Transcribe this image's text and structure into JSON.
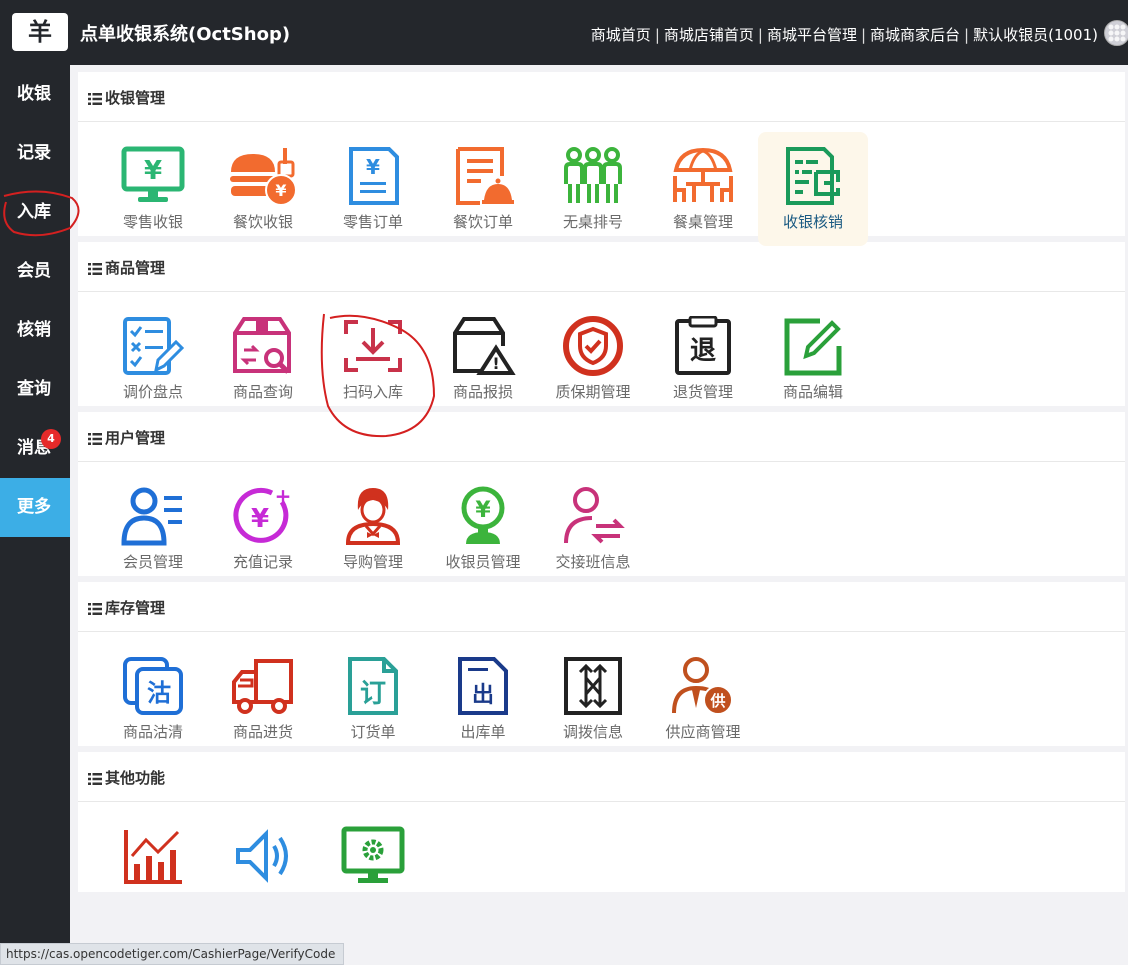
{
  "header": {
    "logo_glyph": "羊",
    "title": "点单收银系统(OctShop)",
    "links": [
      {
        "label": "商城首页"
      },
      {
        "label": "商城店铺首页"
      },
      {
        "label": "商城平台管理"
      },
      {
        "label": "商城商家后台"
      },
      {
        "label": "默认收银员(1001)"
      }
    ],
    "separator": "|"
  },
  "sidebar": {
    "items": [
      {
        "label": "收银"
      },
      {
        "label": "记录"
      },
      {
        "label": "入库"
      },
      {
        "label": "会员"
      },
      {
        "label": "核销"
      },
      {
        "label": "查询"
      },
      {
        "label": "消息",
        "badge": "4"
      },
      {
        "label": "更多",
        "active": true
      }
    ]
  },
  "sections": [
    {
      "title": "收银管理",
      "items": [
        {
          "label": "零售收银",
          "icon": "monitor-yen-icon",
          "color": "#2bb673"
        },
        {
          "label": "餐饮收银",
          "icon": "burger-yen-icon",
          "color": "#f26b2f"
        },
        {
          "label": "零售订单",
          "icon": "document-yen-icon",
          "color": "#2e8de0"
        },
        {
          "label": "餐饮订单",
          "icon": "food-order-icon",
          "color": "#f26b2f"
        },
        {
          "label": "无桌排号",
          "icon": "people-queue-icon",
          "color": "#3cb43c"
        },
        {
          "label": "餐桌管理",
          "icon": "table-umbrella-icon",
          "color": "#f26b2f"
        },
        {
          "label": "收银核销",
          "icon": "scan-verify-icon",
          "color": "#1a9a5a",
          "active": true
        }
      ]
    },
    {
      "title": "商品管理",
      "items": [
        {
          "label": "调价盘点",
          "icon": "checklist-pencil-icon",
          "color": "#2e8de0"
        },
        {
          "label": "商品查询",
          "icon": "box-search-icon",
          "color": "#c8327a"
        },
        {
          "label": "扫码入库",
          "icon": "scan-inbound-icon",
          "color": "#c8324a"
        },
        {
          "label": "商品报损",
          "icon": "box-warning-icon",
          "color": "#222222"
        },
        {
          "label": "质保期管理",
          "icon": "shield-check-icon",
          "color": "#d0311e"
        },
        {
          "label": "退货管理",
          "icon": "clipboard-return-icon",
          "color": "#222222"
        },
        {
          "label": "商品编辑",
          "icon": "edit-pencil-icon",
          "color": "#2aa03a"
        }
      ]
    },
    {
      "title": "用户管理",
      "items": [
        {
          "label": "会员管理",
          "icon": "member-list-icon",
          "color": "#1f6fd6"
        },
        {
          "label": "充值记录",
          "icon": "recharge-yen-icon",
          "color": "#c62ad6"
        },
        {
          "label": "导购管理",
          "icon": "shopping-guide-icon",
          "color": "#d0311e"
        },
        {
          "label": "收银员管理",
          "icon": "cashier-yen-icon",
          "color": "#3cb43c"
        },
        {
          "label": "交接班信息",
          "icon": "shift-handover-icon",
          "color": "#c8327a"
        }
      ]
    },
    {
      "title": "库存管理",
      "items": [
        {
          "label": "商品沽清",
          "icon": "sold-out-icon",
          "color": "#1f6fd6",
          "glyph": "沽"
        },
        {
          "label": "商品进货",
          "icon": "delivery-truck-icon",
          "color": "#d0311e"
        },
        {
          "label": "订货单",
          "icon": "purchase-order-icon",
          "color": "#2aa097",
          "glyph": "订"
        },
        {
          "label": "出库单",
          "icon": "outbound-order-icon",
          "color": "#1a3a8a",
          "glyph": "出"
        },
        {
          "label": "调拨信息",
          "icon": "transfer-arrows-icon",
          "color": "#222222"
        },
        {
          "label": "供应商管理",
          "icon": "supplier-icon",
          "color": "#c0501e",
          "glyph": "供"
        }
      ]
    },
    {
      "title": "其他功能",
      "items": [
        {
          "label": "",
          "icon": "bar-chart-icon",
          "color": "#d0311e"
        },
        {
          "label": "",
          "icon": "speaker-icon",
          "color": "#2e8de0"
        },
        {
          "label": "",
          "icon": "settings-monitor-icon",
          "color": "#2aa03a"
        }
      ]
    }
  ],
  "misc_glyphs": {
    "yen": "¥",
    "return_glyph": "退",
    "plus": "+",
    "warning": "!"
  },
  "status_bar": {
    "url": "https://cas.opencodetiger.com/CashierPage/VerifyCode"
  }
}
